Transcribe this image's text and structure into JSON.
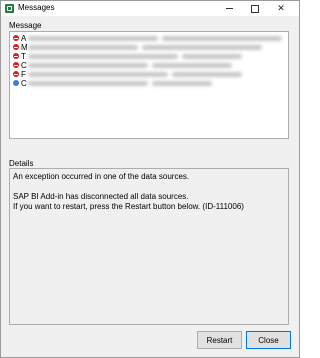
{
  "window": {
    "title": "Messages",
    "minimize_icon": "minimize-icon",
    "maximize_icon": "maximize-icon",
    "close_icon": "close-icon"
  },
  "messages": {
    "label": "Message",
    "rows": [
      {
        "icon": "error-icon",
        "first_char": "A"
      },
      {
        "icon": "error-icon",
        "first_char": "M"
      },
      {
        "icon": "error-icon",
        "first_char": "T"
      },
      {
        "icon": "error-icon",
        "first_char": "C"
      },
      {
        "icon": "error-icon",
        "first_char": "F"
      },
      {
        "icon": "info-icon",
        "first_char": "C"
      }
    ]
  },
  "details": {
    "label": "Details",
    "line1": "An exception occurred in one of the data sources.",
    "line2": "SAP BI Add-in has disconnected all data sources.",
    "line3": "If you want to restart, press the Restart button below. (ID-111006)"
  },
  "buttons": {
    "restart": "Restart",
    "close": "Close"
  },
  "colors": {
    "error": "#d32020",
    "info": "#3a7fd4",
    "focus_border": "#0078d7"
  }
}
